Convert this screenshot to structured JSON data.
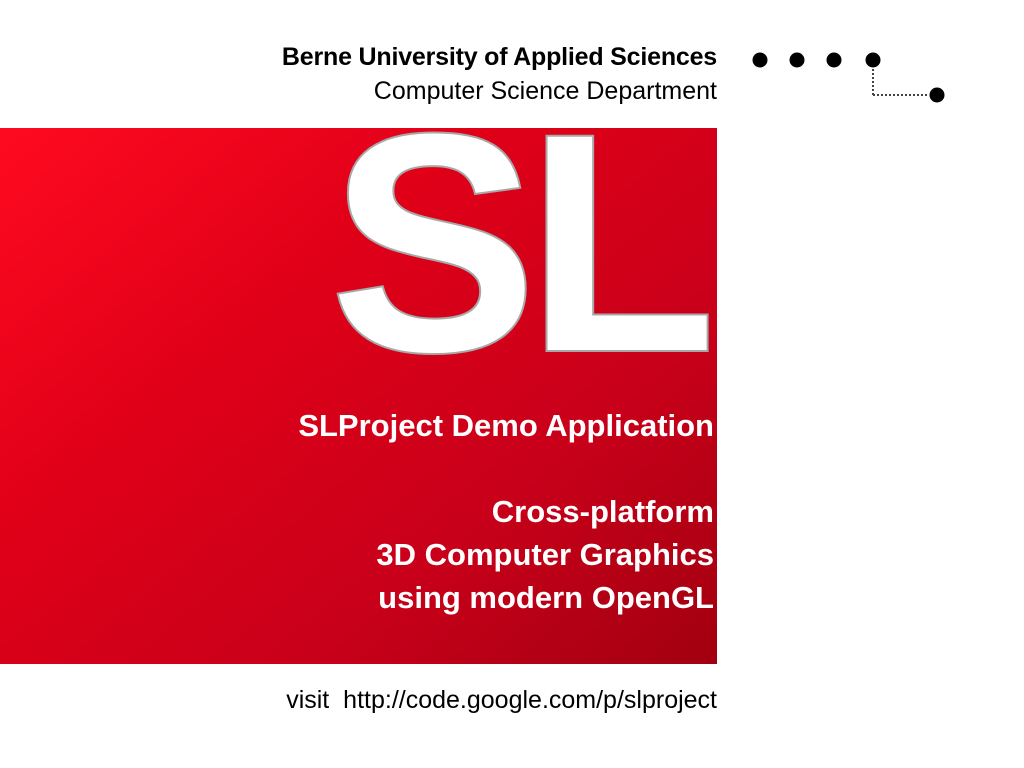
{
  "header": {
    "university": "Berne University of Applied Sciences",
    "department": "Computer Science Department"
  },
  "logo": {
    "icon": "bfh-dots-logo-icon"
  },
  "banner": {
    "mark": "SL",
    "title": "SLProject Demo Application",
    "lines": [
      "Cross-platform",
      "3D Computer Graphics",
      "using modern OpenGL"
    ],
    "colors": {
      "start": "#ff0a20",
      "end": "#a2000f"
    }
  },
  "footer": {
    "visit_label": "visit",
    "url": "http://code.google.com/p/slproject"
  }
}
